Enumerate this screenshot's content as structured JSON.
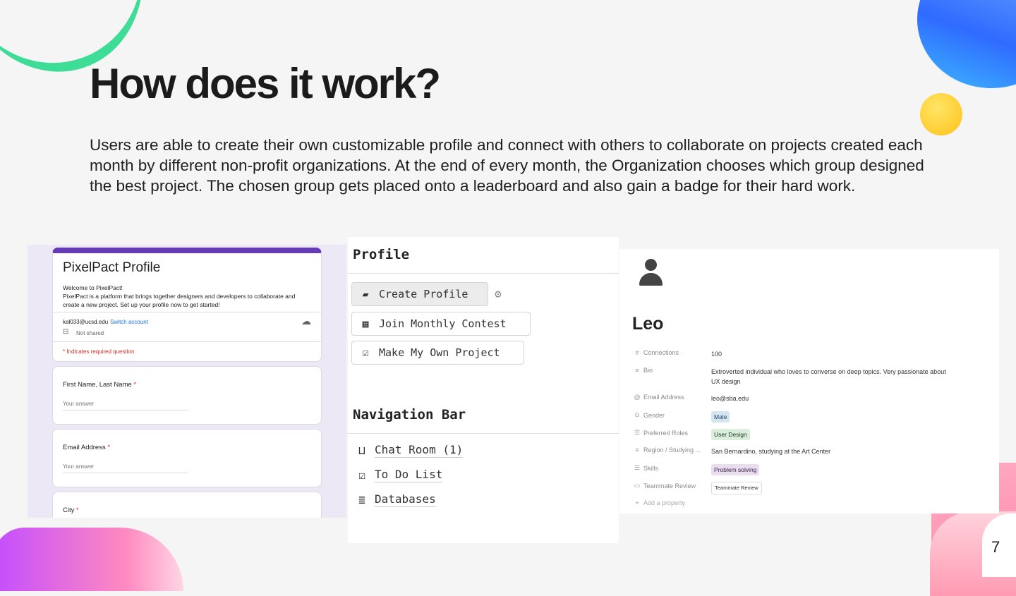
{
  "slide": {
    "title": "How does it work?",
    "body": "Users are able to create their own customizable profile and connect with others to collaborate on projects created each month by different non-profit organizations. At the end of every month, the Organization chooses which group designed the best project. The chosen group gets placed onto a leaderboard and also gain a badge for their hard work.",
    "page_number": "7"
  },
  "form": {
    "title": "PixelPact Profile",
    "description": "Welcome to PixelPact!\nPixelPact is a platform that brings together designers and developers to collaborate and create a new project. Set up your profile now to get started!",
    "account_email": "kal033@ucsd.edu",
    "switch_account": "Switch account",
    "not_shared": "Not shared",
    "required_note": "* Indicates required question",
    "questions": [
      {
        "label": "First Name, Last Name",
        "required_mark": "*",
        "answer_placeholder": "Your answer"
      },
      {
        "label": "Email Address",
        "required_mark": "*",
        "answer_placeholder": "Your answer"
      },
      {
        "label": "City",
        "required_mark": "*"
      }
    ]
  },
  "menu": {
    "profile_heading": "Profile",
    "buttons": [
      {
        "label": "Create Profile",
        "icon": "note-icon"
      },
      {
        "label": "Join Monthly Contest",
        "icon": "calendar-icon"
      },
      {
        "label": "Make My Own Project",
        "icon": "checkbox-icon"
      }
    ],
    "nav_heading": "Navigation Bar",
    "nav_items": [
      {
        "label": "Chat Room (1)",
        "icon": "inbox-icon"
      },
      {
        "label": "To Do List",
        "icon": "checkbox-icon"
      },
      {
        "label": "Databases",
        "icon": "database-icon"
      }
    ]
  },
  "profile": {
    "name": "Leo",
    "properties": [
      {
        "key": "Connections",
        "value": "100",
        "icon": "hash-icon"
      },
      {
        "key": "Bio",
        "value": "Extroverted individual who loves to converse on deep topics. Very passionate about UX design",
        "icon": "lines-icon"
      },
      {
        "key": "Email Address",
        "value": "leo@sba.edu",
        "icon": "at-icon"
      },
      {
        "key": "Gender",
        "value": "Male",
        "icon": "select-icon"
      },
      {
        "key": "Preferred Roles",
        "value": "User Design",
        "icon": "list-icon"
      },
      {
        "key": "Region / Studying ...",
        "value": "San Bernardino, studying at the Art Center",
        "icon": "lines-icon"
      },
      {
        "key": "Skills",
        "value": "Problem solving",
        "icon": "list-icon"
      },
      {
        "key": "Teammate Review",
        "value": "Teammate Review",
        "icon": "review-icon"
      }
    ],
    "add_property": "Add a property"
  }
}
